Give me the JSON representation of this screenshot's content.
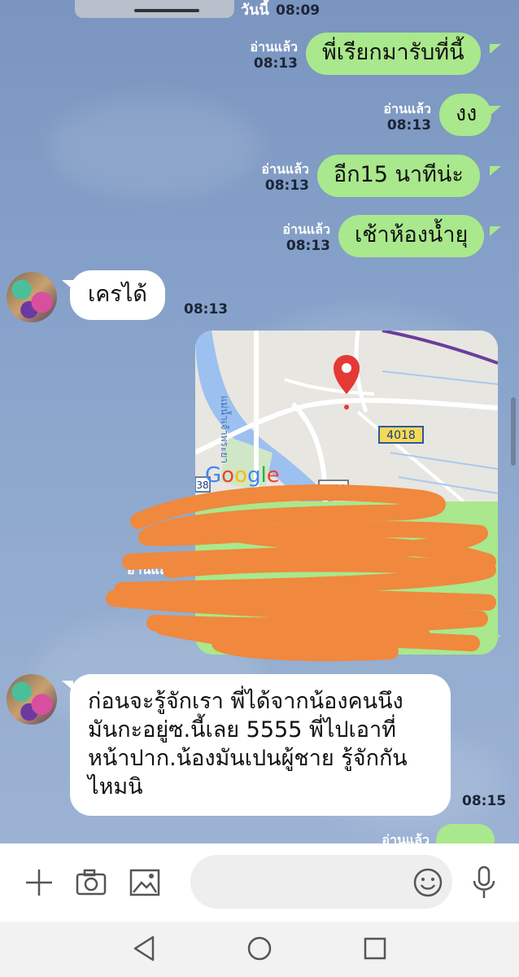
{
  "header": {
    "date_chip": "วันนี้",
    "clipped_time": "08:09"
  },
  "messages_out": [
    {
      "text": "พี่เรียกมารับที่นี้",
      "read": "อ่านแล้ว",
      "time": "08:13"
    },
    {
      "text": "งง",
      "read": "อ่านแล้ว",
      "time": "08:13"
    },
    {
      "text": "อีก15  นาทีน่ะ",
      "read": "อ่านแล้ว",
      "time": "08:13"
    },
    {
      "text": "เช้าห้องน้ำยุ",
      "read": "อ่านแล้ว",
      "time": "08:13"
    }
  ],
  "message_in_1": {
    "text": "เครได้",
    "time": "08:13"
  },
  "location_card": {
    "map_logo": "Google",
    "road_label_1": "4018",
    "road_label_2": "3110",
    "road_label_3": "38",
    "river_label": "แม่น้ำเจ้าพระยา",
    "time": "08:14",
    "read": "อ่านแล้ว",
    "accent_pin": "#e53935"
  },
  "message_in_2": {
    "lines": [
      "ก่อนจะรู้จักเรา พี่ได้จากน้องคนนึง",
      "มันกะอยู่ซ.นี้เลย 5555 พี่ไปเอาที่",
      "หน้าปาก.น้องมันเปนผู้ชาย รู้จักกัน",
      "ไหมนิ"
    ],
    "time": "08:15"
  },
  "partial_out": {
    "read": "อ่านแล้ว"
  },
  "input_bar": {
    "placeholder": "",
    "icons": [
      "plus-icon",
      "camera-icon",
      "image-icon",
      "emoji-icon",
      "microphone-icon"
    ]
  },
  "nav_bar": {
    "icons": [
      "back-icon",
      "home-icon",
      "recents-icon"
    ]
  },
  "colors": {
    "bubble_out": "#a9e88c",
    "bubble_in": "#ffffff",
    "scribble": "#f0883e"
  }
}
